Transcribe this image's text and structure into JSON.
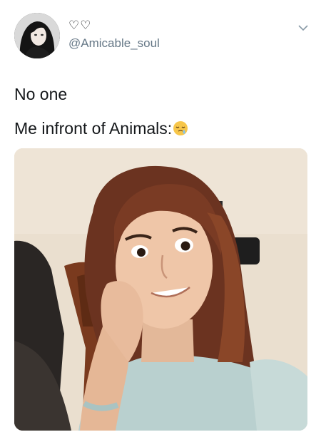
{
  "tweet": {
    "display_name": "♡♡",
    "handle": "@Amicable_soul",
    "line1": "No one",
    "line2": "Me infront of Animals:"
  },
  "icons": {
    "avatar": "profile-photo",
    "caret": "chevron-down-icon",
    "emoji": "sleepy-face-emoji"
  },
  "colors": {
    "text": "#14171a",
    "handle": "#657786",
    "background": "#ffffff"
  }
}
